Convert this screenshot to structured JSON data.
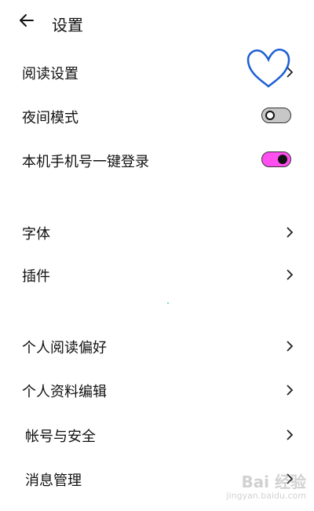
{
  "header": {
    "title": "设置",
    "back_icon": "arrow-left-icon"
  },
  "settings": [
    {
      "label": "阅读设置",
      "type": "chevron"
    },
    {
      "label": "夜间模式",
      "type": "toggle",
      "value": false
    },
    {
      "label": "本机手机号一键登录",
      "type": "toggle",
      "value": true
    },
    {
      "label": "字体",
      "type": "chevron"
    },
    {
      "label": "插件",
      "type": "chevron"
    },
    {
      "label": "个人阅读偏好",
      "type": "chevron"
    },
    {
      "label": "个人资料编辑",
      "type": "chevron"
    },
    {
      "label": "帐号与安全",
      "type": "chevron"
    },
    {
      "label": "消息管理",
      "type": "chevron"
    }
  ],
  "annotation": {
    "icon": "heart-icon",
    "color": "#1c5fd4"
  },
  "toggle_colors": {
    "on": "#ff4ff0",
    "off": "#c7c7c7"
  },
  "watermark": {
    "brand": "Bai 经验",
    "url": "jingyan.baidu.com"
  }
}
